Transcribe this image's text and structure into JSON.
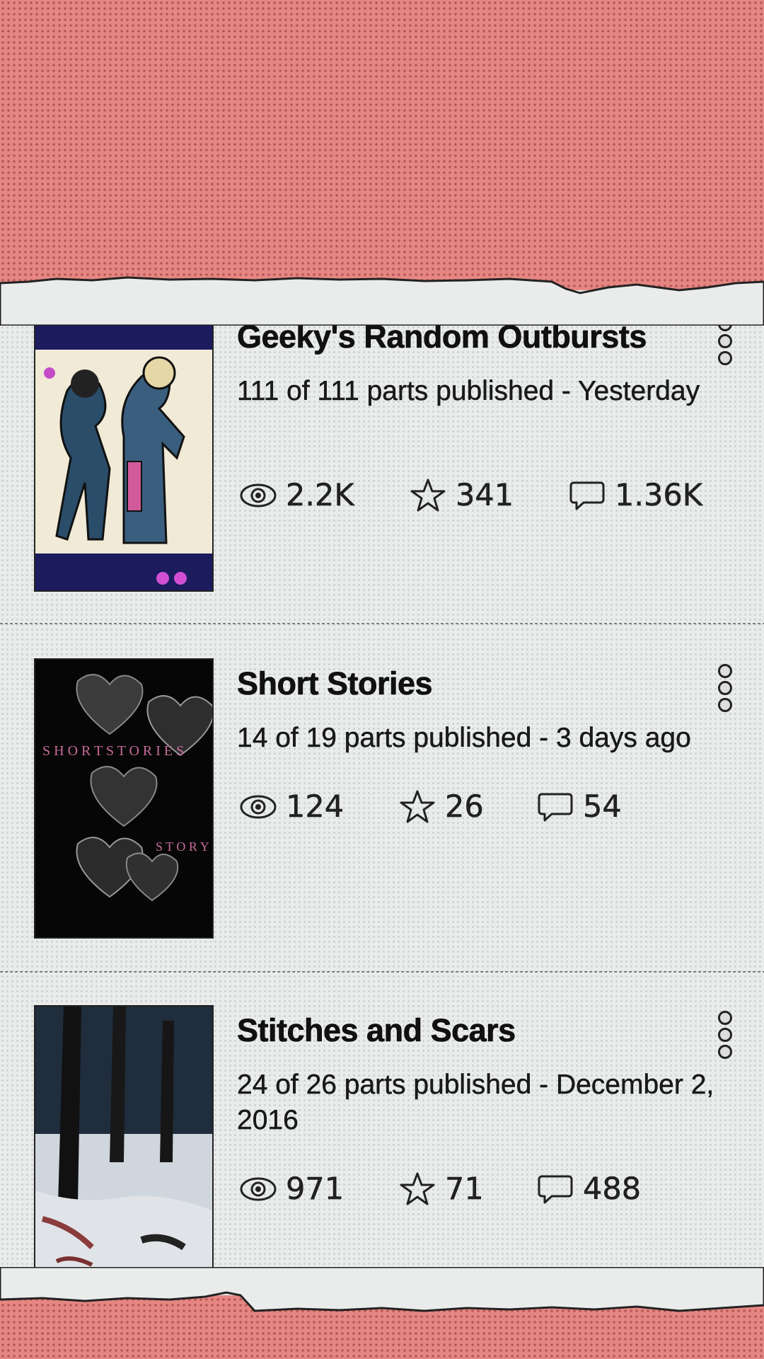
{
  "stories": [
    {
      "title": "Geeky's Random Outbursts",
      "meta": "111 of 111 parts published - Yesterday",
      "reads": "2.2K",
      "votes": "341",
      "comments": "1.36K"
    },
    {
      "title": "Short Stories",
      "meta": "14 of 19 parts published - 3 days ago",
      "reads": "124",
      "votes": "26",
      "comments": "54"
    },
    {
      "title": "Stitches and Scars",
      "meta": "24 of 26 parts published - December 2, 2016",
      "reads": "971",
      "votes": "71",
      "comments": "488"
    }
  ],
  "colors": {
    "background": "#e68682",
    "card": "#e9ecea",
    "text": "#111111"
  }
}
